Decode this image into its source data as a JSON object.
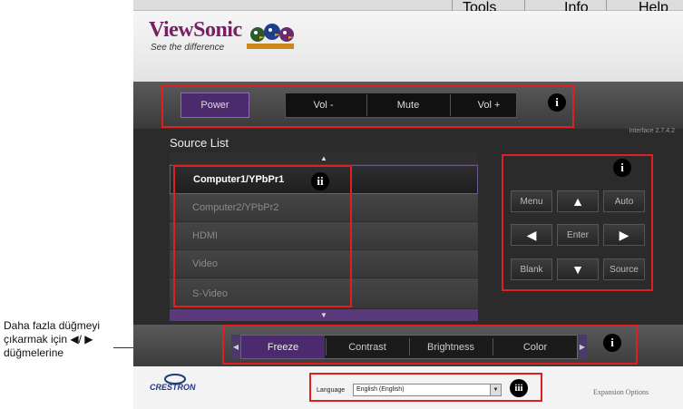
{
  "menu": {
    "tools": "Tools",
    "info": "Info",
    "help": "Help"
  },
  "brand": {
    "name": "ViewSonic",
    "tagline": "See the difference"
  },
  "controls": {
    "power": "Power",
    "vol_down": "Vol -",
    "mute": "Mute",
    "vol_up": "Vol +"
  },
  "version": "Interface 2.7.4.2",
  "source_list": {
    "title": "Source List",
    "items": [
      "Computer1/YPbPr1",
      "Computer2/YPbPr2",
      "HDMI",
      "Video",
      "S-Video"
    ],
    "selected": "Computer1/YPbPr1"
  },
  "remote": {
    "menu": "Menu",
    "auto": "Auto",
    "enter": "Enter",
    "blank": "Blank",
    "source": "Source"
  },
  "adjustments": {
    "items": [
      "Freeze",
      "Contrast",
      "Brightness",
      "Color"
    ],
    "selected": "Freeze"
  },
  "footer": {
    "crestron": "CRESTRON",
    "language_label": "Language",
    "language_value": "English (English)",
    "expansion": "Expansion Options"
  },
  "annotations": {
    "badge_i": "i",
    "badge_ii": "ii",
    "badge_iii": "iii"
  },
  "caption": "Daha fazla düğmeyi çıkarmak için ◀/ ▶ düğmelerine",
  "colors": {
    "accent": "#4b2a6e",
    "annotation": "#e02020"
  }
}
